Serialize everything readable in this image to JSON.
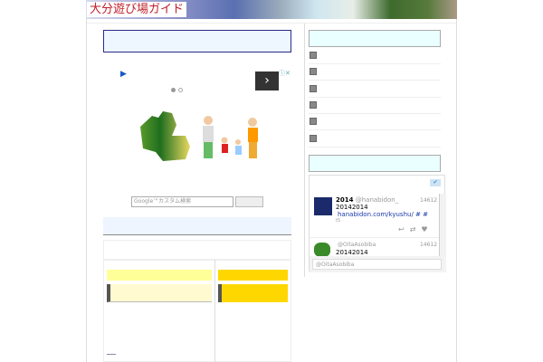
{
  "header": {
    "site_title": "大分遊び場ガイド"
  },
  "ad": {
    "mark": "▶",
    "next": "›",
    "adchoice": "ⓘ✕"
  },
  "search": {
    "placeholder": "Google™カスタム検索",
    "button": ""
  },
  "twitter": {
    "tweets": [
      {
        "name": "2014",
        "handle": "@hanabidon_",
        "date": "14612",
        "text": "20142014",
        "link": "hanabidon.com/kyushu/ # #",
        "extra": "t5"
      },
      {
        "name": "",
        "handle": "@OitaAsobiba",
        "date": "14612",
        "text": "20142014"
      }
    ],
    "compose_placeholder": "@OitaAsobiba"
  },
  "colors": {
    "accent": "#c0202a",
    "nav": "#2a2a8a"
  }
}
